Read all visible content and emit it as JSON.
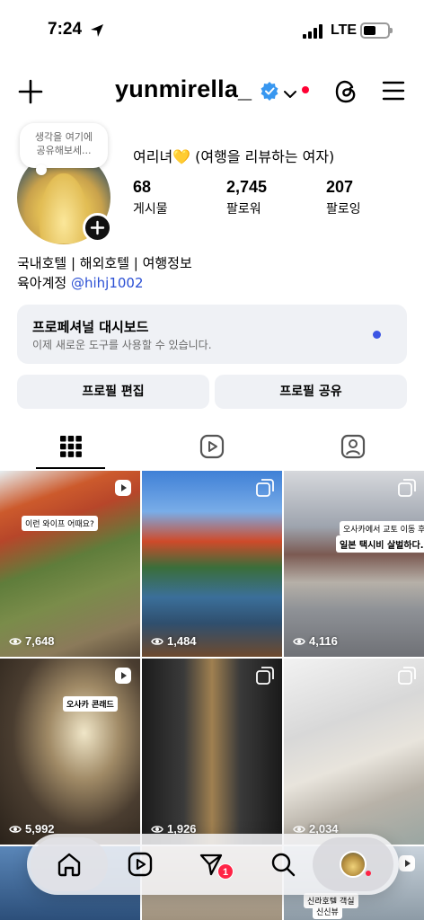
{
  "status_bar": {
    "time": "7:24",
    "network": "LTE"
  },
  "header": {
    "username": "yunmirella_"
  },
  "note": {
    "text_line1": "생각을 여기에",
    "text_line2": "공유해보세..."
  },
  "profile": {
    "display_name": "여리녀💛 (여행을 리뷰하는 여자)",
    "stats": [
      {
        "value": "68",
        "label": "게시물"
      },
      {
        "value": "2,745",
        "label": "팔로워"
      },
      {
        "value": "207",
        "label": "팔로잉"
      }
    ],
    "bio_line1": "국내호텔 | 해외호텔 | 여행정보",
    "bio_line2_prefix": "육아계정",
    "bio_mention": "@hihj1002"
  },
  "dashboard": {
    "title": "프로페셔널 대시보드",
    "subtitle": "이제 새로운 도구를 사용할 수 있습니다."
  },
  "buttons": {
    "edit": "프로필 편집",
    "share": "프로필 공유"
  },
  "posts": [
    {
      "views": "7,648",
      "caption": "이런 와이프 어때요?",
      "type": "reel"
    },
    {
      "views": "1,484",
      "caption": "",
      "type": "carousel"
    },
    {
      "views": "4,116",
      "caption": "오사카에서 교토 이동 후,",
      "caption2": "일본 택시비 살벌하다.",
      "type": "carousel"
    },
    {
      "views": "5,992",
      "caption": "오사카 콘래드",
      "type": "reel"
    },
    {
      "views": "1,926",
      "caption": "",
      "type": "carousel"
    },
    {
      "views": "2,034",
      "caption": "",
      "type": "carousel"
    },
    {
      "views": "",
      "caption": "",
      "type": ""
    },
    {
      "views": "",
      "caption": "신라호텔 객실",
      "caption2": "신신뷰",
      "type": ""
    },
    {
      "views": "",
      "caption": "",
      "type": "reel"
    }
  ],
  "nav": {
    "notification_count": "1"
  },
  "colors": {
    "verified": "#3897f0",
    "mention": "#2a4fd4",
    "notification": "#ff2345",
    "dashboard_dot": "#3c55e4"
  }
}
